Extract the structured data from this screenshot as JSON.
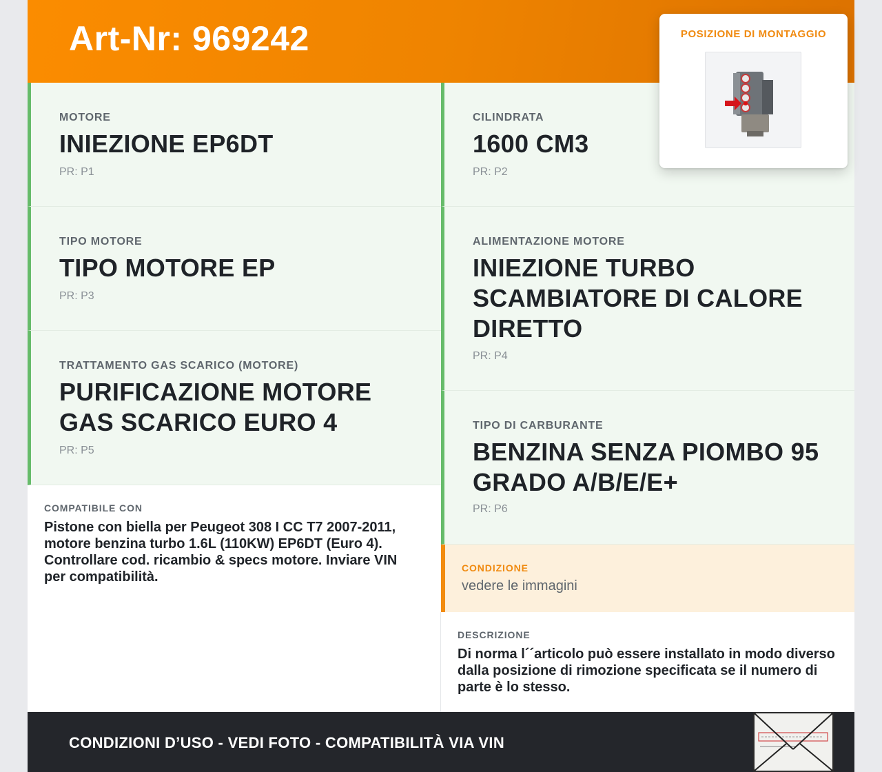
{
  "header": {
    "title": "Art-Nr: 969242"
  },
  "mount": {
    "title": "POSIZIONE DI MONTAGGIO",
    "image_icon": "engine-block-with-red-arrow"
  },
  "specs": {
    "motore": {
      "label": "MOTORE",
      "value": "INIEZIONE EP6DT",
      "pr": "PR: P1"
    },
    "cilindrata": {
      "label": "CILINDRATA",
      "value": "1600 CM3",
      "pr": "PR: P2"
    },
    "tipo_motore": {
      "label": "TIPO MOTORE",
      "value": "TIPO MOTORE EP",
      "pr": "PR: P3"
    },
    "alimentazione": {
      "label": "ALIMENTAZIONE MOTORE",
      "value": "INIEZIONE TURBO SCAMBIATORE DI CALORE DIRETTO",
      "pr": "PR: P4"
    },
    "trattamento": {
      "label": "TRATTAMENTO GAS SCARICO (MOTORE)",
      "value": "PURIFICAZIONE MOTORE GAS SCARICO EURO 4",
      "pr": "PR: P5"
    },
    "carburante": {
      "label": "TIPO DI CARBURANTE",
      "value": "BENZINA SENZA PIOMBO 95 GRADO A/B/E/E+",
      "pr": "PR: P6"
    }
  },
  "compatibile": {
    "label": "COMPATIBILE CON",
    "text": "Pistone con biella per Peugeot 308 I CC T7 2007-2011, motore benzina turbo 1.6L (110KW) EP6DT (Euro 4). Controllare cod. ricambio & specs motore. Inviare VIN per compatibilità."
  },
  "condizione": {
    "label": "CONDIZIONE",
    "text": "vedere le immagini"
  },
  "descrizione": {
    "label": "DESCRIZIONE",
    "text": "Di norma l´´articolo può essere installato in modo diverso dalla posizione di rimozione specificata se il numero di parte è lo stesso."
  },
  "footer": {
    "text": "CONDIZIONI D’USO - VEDI FOTO - COMPATIBILITÀ VIA VIN",
    "stamp_icon": "envelope-stamp"
  },
  "colors": {
    "accent": "#fb8c00",
    "green": "#66bb6a",
    "footer_bg": "#24262b"
  }
}
